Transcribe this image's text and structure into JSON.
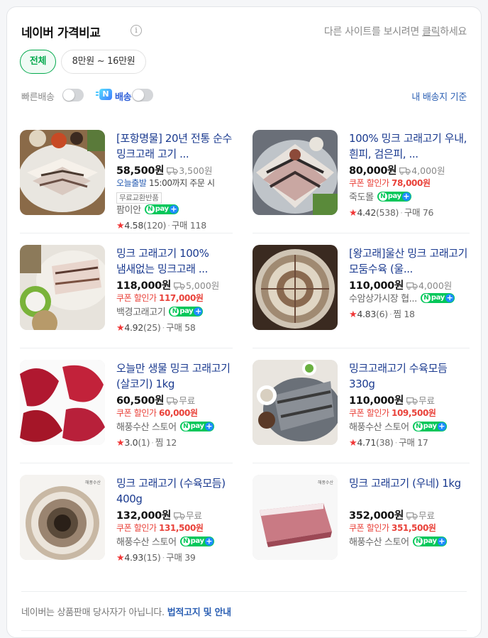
{
  "header": {
    "title": "네이버 가격비교",
    "other_site_prefix": "다른 사이트를 보시려면 ",
    "other_site_link": "클릭",
    "other_site_suffix": "하세요"
  },
  "filters": {
    "all": "전체",
    "range": "8만원 ~ 16만원"
  },
  "toggles": {
    "fast_delivery": "빠른배송",
    "npay_delivery_badge": "N",
    "npay_delivery": "배송",
    "my_delivery": "내 배송지 기준"
  },
  "npay_badge": {
    "n": "N",
    "text": "pay",
    "plus": "+"
  },
  "products": [
    {
      "name": "[포항명물] 20년 전통 순수 밍크고래 고기 ...",
      "price": "58,500원",
      "shipping": "3,500원",
      "today_label": "오늘출발",
      "today_text": " 15:00까지 주문 시",
      "tag": "무료교환반품",
      "seller": "팜이안",
      "npay": true,
      "rating": "4.58",
      "rating_count": "(120)",
      "sales_label": "구매 118"
    },
    {
      "name": "100% 밍크 고래고기 우내, 흰피, 검은피, ...",
      "price": "80,000원",
      "shipping": "4,000원",
      "coupon_label": "쿠폰 할인가 ",
      "coupon_price": "78,000원",
      "seller": "죽도몰",
      "npay": true,
      "rating": "4.42",
      "rating_count": "(538)",
      "sales_label": "구매 76"
    },
    {
      "name": "밍크 고래고기 100% 냄새없는 밍크고래 ...",
      "price": "118,000원",
      "shipping": "5,000원",
      "coupon_label": "쿠폰 할인가 ",
      "coupon_price": "117,000원",
      "seller": "백경고래고기",
      "npay": true,
      "rating": "4.92",
      "rating_count": "(25)",
      "sales_label": "구매 58"
    },
    {
      "name": "[왕고래]울산 밍크 고래고기 모둠수육 (울...",
      "price": "110,000원",
      "shipping": "4,000원",
      "seller": "수암상가시장 협...",
      "npay": true,
      "rating": "4.83",
      "rating_count": "(6)",
      "sales_label": "찜 18"
    },
    {
      "name": "오늘만 생물 밍크 고래고기 (살코기) 1kg",
      "price": "60,500원",
      "shipping": "무료",
      "coupon_label": "쿠폰 할인가 ",
      "coupon_price": "60,000원",
      "seller": "해풍수산 스토어",
      "npay": true,
      "rating": "3.0",
      "rating_count": "(1)",
      "sales_label": "찜 12"
    },
    {
      "name": "밍크고래고기 수육모듬 330g",
      "price": "110,000원",
      "shipping": "무료",
      "coupon_label": "쿠폰 할인가 ",
      "coupon_price": "109,500원",
      "seller": "해풍수산 스토어",
      "npay": true,
      "rating": "4.71",
      "rating_count": "(38)",
      "sales_label": "구매 17"
    },
    {
      "name": "밍크 고래고기 (수육모듬) 400g",
      "price": "132,000원",
      "shipping": "무료",
      "coupon_label": "쿠폰 할인가 ",
      "coupon_price": "131,500원",
      "seller": "해풍수산 스토어",
      "npay": true,
      "rating": "4.93",
      "rating_count": "(15)",
      "sales_label": "구매 39"
    },
    {
      "name": "밍크 고래고기 (우네) 1kg",
      "price": "352,000원",
      "shipping": "무료",
      "coupon_label": "쿠폰 할인가 ",
      "coupon_price": "351,500원",
      "seller": "해풍수산 스토어",
      "npay": true,
      "rating": "",
      "rating_count": "",
      "sales_label": ""
    }
  ],
  "footer": {
    "text": "네이버는 상품판매 당사자가 아닙니다. ",
    "link": "법적고지 및 안내"
  },
  "colors": {
    "accent_green": "#03a94d",
    "link_blue": "#1a3a8f",
    "coupon_red": "#e9423a",
    "star_red": "#f03737",
    "npay_green": "#03c75a"
  }
}
